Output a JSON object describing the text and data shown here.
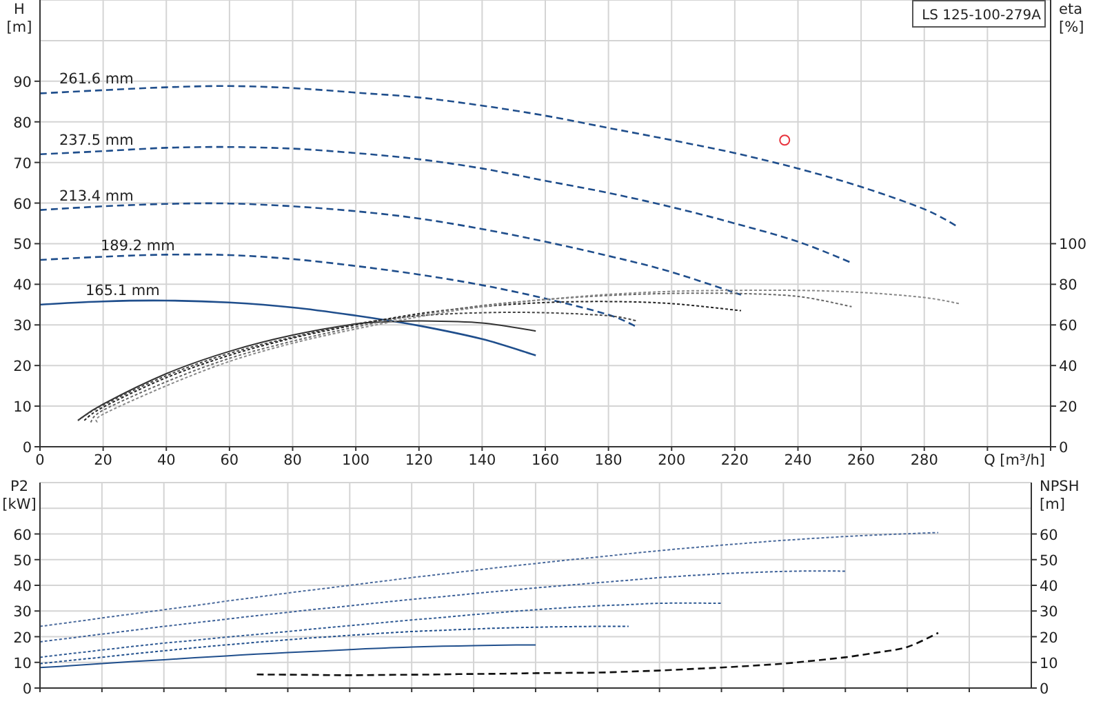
{
  "head_chart": {
    "chart_data": {
      "type": "line",
      "title": "LS 125-100-279A",
      "xlabel": "Q [m³/h]",
      "ylabel": "H [m]",
      "xlim": [
        0,
        320
      ],
      "ylim": [
        0,
        110
      ],
      "grid": true,
      "xticks": [
        0,
        20,
        40,
        60,
        80,
        100,
        120,
        140,
        160,
        180,
        200,
        220,
        240,
        260,
        280
      ],
      "yticks": [
        0,
        10,
        20,
        30,
        40,
        50,
        60,
        70,
        80,
        90
      ],
      "series": [
        {
          "line_style": "dashed",
          "color": "#1f4e8c",
          "x": [
            0,
            20,
            40,
            60,
            80,
            100,
            120,
            140,
            160,
            180,
            200,
            220,
            240,
            260,
            280,
            291
          ],
          "values": [
            87,
            87.8,
            88.5,
            88.8,
            88.3,
            87.2,
            86,
            84,
            81.5,
            78.5,
            75.5,
            72.3,
            68.5,
            64,
            58.5,
            54
          ]
        },
        {
          "line_style": "dashed",
          "color": "#1f4e8c",
          "x": [
            0,
            20,
            40,
            60,
            80,
            100,
            120,
            140,
            160,
            180,
            200,
            220,
            240,
            257
          ],
          "values": [
            72,
            72.8,
            73.6,
            73.8,
            73.4,
            72.3,
            70.8,
            68.5,
            65.5,
            62.5,
            59,
            55,
            50.5,
            45.3
          ]
        },
        {
          "line_style": "dashed",
          "color": "#1f4e8c",
          "x": [
            0,
            20,
            40,
            60,
            80,
            100,
            120,
            140,
            160,
            180,
            200,
            222
          ],
          "values": [
            58.3,
            59.2,
            59.8,
            59.9,
            59.2,
            58,
            56.2,
            53.6,
            50.5,
            47,
            43,
            37.4
          ]
        },
        {
          "line_style": "dashed",
          "color": "#1f4e8c",
          "x": [
            0,
            20,
            40,
            60,
            80,
            100,
            120,
            140,
            160,
            180,
            189
          ],
          "values": [
            46,
            46.8,
            47.3,
            47.2,
            46.2,
            44.5,
            42.4,
            39.8,
            36.5,
            32.5,
            29.5
          ]
        },
        {
          "line_style": "solid",
          "color": "#1f4e8c",
          "x": [
            0,
            20,
            40,
            60,
            80,
            100,
            120,
            140,
            157
          ],
          "values": [
            35,
            35.8,
            36,
            35.5,
            34.3,
            32.3,
            29.8,
            26.5,
            22.5
          ]
        },
        {
          "marker": true,
          "color": "#e8323c",
          "x": [
            235.8
          ],
          "values": [
            75.5
          ]
        }
      ],
      "annotations": [
        "261.6 mm",
        "237.5 mm",
        "213.4 mm",
        "189.2 mm",
        "165.1 mm"
      ]
    }
  },
  "efficiency_chart": {
    "chart_data": {
      "type": "line",
      "ylabel": "eta [%]",
      "xlim": [
        0,
        320
      ],
      "ylim": [
        0,
        220
      ],
      "yticks": [
        0,
        20,
        40,
        60,
        80,
        100
      ],
      "series": [
        {
          "line_style": "solid",
          "color": "#333333",
          "x": [
            12,
            20,
            40,
            60,
            80,
            100,
            110,
            120,
            140,
            157
          ],
          "values": [
            13,
            21,
            36,
            47,
            55,
            60.5,
            61.5,
            62,
            61,
            57
          ]
        },
        {
          "line_style": "dotted",
          "color": "#444444",
          "x": [
            12,
            20,
            40,
            60,
            80,
            100,
            120,
            140,
            160,
            180,
            189
          ],
          "values": [
            13,
            20.5,
            35,
            46,
            54,
            60.5,
            64.5,
            66,
            66,
            64.5,
            62
          ]
        },
        {
          "line_style": "dotted",
          "color": "#222222",
          "x": [
            14,
            20,
            40,
            60,
            80,
            100,
            120,
            140,
            160,
            180,
            200,
            222
          ],
          "values": [
            13,
            19.5,
            34,
            45,
            53.5,
            60,
            65.5,
            69,
            71,
            71.5,
            70.5,
            67
          ]
        },
        {
          "line_style": "dotted",
          "color": "#666666",
          "x": [
            16,
            20,
            40,
            60,
            80,
            100,
            120,
            140,
            160,
            180,
            200,
            220,
            240,
            257
          ],
          "values": [
            12,
            18,
            32,
            43.5,
            52,
            59,
            65,
            69.5,
            72.5,
            74.5,
            75.5,
            75.5,
            74,
            69
          ]
        },
        {
          "line_style": "dotted",
          "color": "#888888",
          "x": [
            18,
            20,
            40,
            60,
            80,
            100,
            120,
            140,
            160,
            180,
            200,
            220,
            240,
            260,
            280,
            291
          ],
          "values": [
            12,
            16,
            30,
            42,
            51,
            58,
            64,
            69,
            72.5,
            75,
            76.5,
            77,
            77,
            76,
            73.5,
            70.5
          ]
        }
      ]
    }
  },
  "power_chart": {
    "chart_data": {
      "type": "line",
      "ylabel": "P2 [kW]",
      "ylim": [
        0,
        80
      ],
      "grid": true,
      "yticks": [
        0,
        10,
        20,
        30,
        40,
        50,
        60
      ],
      "categories": [
        null,
        null,
        null,
        null,
        null,
        null,
        null,
        null,
        null,
        null,
        null,
        null,
        null,
        null,
        null,
        null,
        null,
        null,
        null,
        null,
        null,
        null,
        null,
        null,
        null,
        null,
        null,
        null,
        null,
        null,
        null
      ],
      "series": [
        {
          "line_style": "solid",
          "color": "#1f4e8c",
          "values": [
            8,
            8.7,
            9.5,
            10.3,
            11,
            11.8,
            12.5,
            13.2,
            13.8,
            14.4,
            15,
            15.5,
            16,
            16.3,
            16.5,
            16.7,
            16.8,
            null,
            null,
            null,
            null,
            null,
            null,
            null,
            null,
            null,
            null,
            null,
            null,
            null,
            null
          ]
        },
        {
          "line_style": "dotted",
          "color": "#1f4e8c",
          "values": [
            9.5,
            10.8,
            12,
            13.3,
            14.5,
            15.7,
            16.8,
            17.8,
            18.8,
            19.7,
            20.5,
            21.3,
            22,
            22.5,
            23,
            23.4,
            23.7,
            23.9,
            24,
            24,
            null,
            null,
            null,
            null,
            null,
            null,
            null,
            null,
            null,
            null,
            null
          ]
        },
        {
          "line_style": "dotted",
          "color": "#2f5a94",
          "values": [
            12,
            13.4,
            14.8,
            16.2,
            17.5,
            18.6,
            19.8,
            20.9,
            22,
            23.2,
            24.3,
            25.4,
            26.5,
            27.5,
            28.6,
            29.6,
            30.5,
            31.3,
            32,
            32.5,
            33,
            33.1,
            33,
            null,
            null,
            null,
            null,
            null,
            null,
            null,
            null
          ]
        },
        {
          "line_style": "dotted",
          "color": "#3c6098",
          "values": [
            18,
            19.5,
            21,
            22.5,
            24,
            25.4,
            26.8,
            28.2,
            29.5,
            30.8,
            32,
            33.3,
            34.5,
            35.6,
            36.8,
            37.9,
            39,
            40,
            41,
            42,
            43,
            43.8,
            44.5,
            45,
            45.4,
            45.6,
            45.5,
            null,
            null,
            null,
            null
          ]
        },
        {
          "line_style": "dotted",
          "color": "#4a6a9c",
          "values": [
            24,
            25.6,
            27.3,
            28.9,
            30.5,
            32.1,
            33.8,
            35.4,
            37,
            38.5,
            40,
            41.5,
            43,
            44.4,
            45.8,
            47.2,
            48.5,
            49.8,
            51,
            52.3,
            53.5,
            54.6,
            55.6,
            56.6,
            57.5,
            58.3,
            59,
            59.6,
            60.1,
            60.5,
            null
          ]
        }
      ]
    }
  },
  "npsh_chart": {
    "chart_data": {
      "type": "line",
      "ylabel": "NPSH [m]",
      "ylim": [
        0,
        80
      ],
      "yticks": [
        0,
        10,
        20,
        30,
        40,
        50,
        60
      ],
      "categories": [
        null,
        null,
        null,
        null,
        null,
        null,
        null,
        null,
        null,
        null,
        null,
        null,
        null,
        null,
        null,
        null,
        null,
        null,
        null,
        null,
        null,
        null,
        null,
        null,
        null,
        null,
        null,
        null,
        null,
        null,
        null
      ],
      "series": [
        {
          "line_style": "dashed",
          "color": "#111111",
          "values": [
            null,
            null,
            null,
            null,
            null,
            null,
            null,
            5.3,
            5.2,
            5.1,
            5,
            5.1,
            5.2,
            5.3,
            5.5,
            5.6,
            5.8,
            5.9,
            6,
            6.4,
            6.8,
            7.4,
            8,
            8.7,
            9.5,
            10.7,
            12,
            13.8,
            16,
            21.5,
            null
          ]
        }
      ]
    }
  }
}
